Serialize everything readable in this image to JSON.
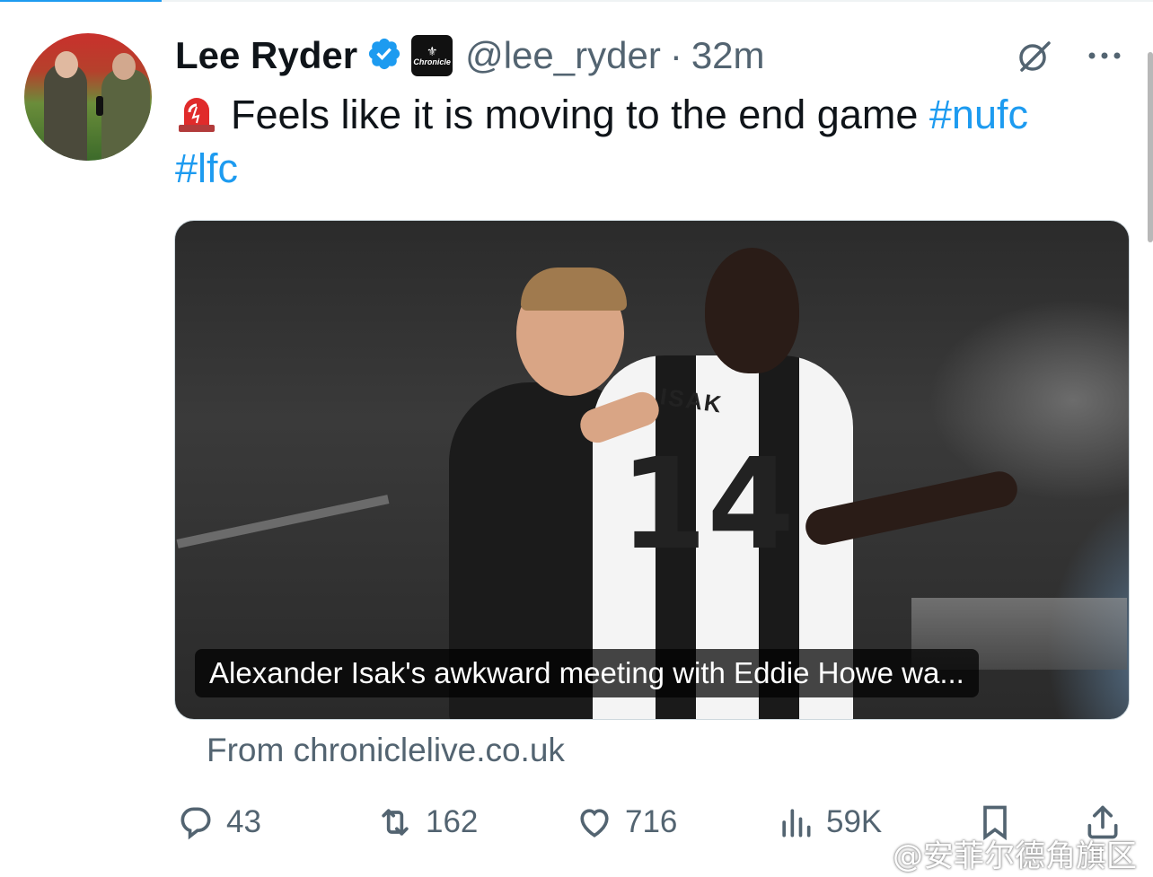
{
  "tweet": {
    "author_name": "Lee Ryder",
    "handle": "@lee_ryder",
    "separator": "·",
    "time": "32m",
    "affiliate_badge": "Chronicle",
    "text": "Feels like it is moving to the end game",
    "hashtags": [
      "#nufc",
      "#lfc"
    ]
  },
  "card": {
    "headline": "Alexander Isak's awkward meeting with Eddie Howe wa...",
    "source": "From chroniclelive.co.uk",
    "jersey_name": "ISAK",
    "jersey_number": "14"
  },
  "actions": {
    "replies": "43",
    "retweets": "162",
    "likes": "716",
    "views": "59K"
  },
  "watermark": "@安菲尔德角旗区",
  "icons": {
    "verified": "verified-badge-icon",
    "grok": "grok-icon",
    "more": "more-icon",
    "siren": "siren-emoji-icon",
    "reply": "reply-icon",
    "retweet": "retweet-icon",
    "like": "heart-icon",
    "views": "views-icon",
    "bookmark": "bookmark-icon",
    "share": "share-icon"
  },
  "colors": {
    "accent": "#1d9bf0",
    "secondary_text": "#536471",
    "text": "#0f1419"
  }
}
